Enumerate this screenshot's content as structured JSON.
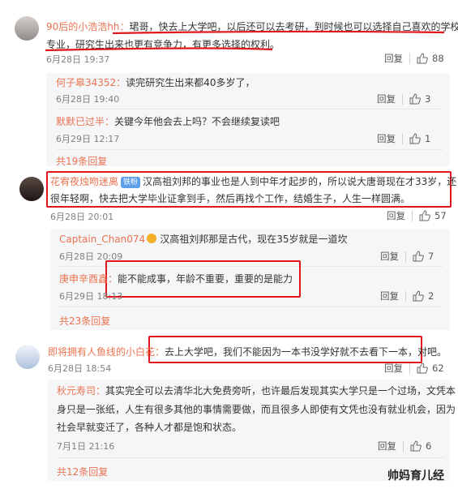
{
  "comments": [
    {
      "user": "90后的小浩浩hh：",
      "lines": [
        "珺哥，快去上大学吧，以后还可以去考研，到时候也可以选择自己喜欢的学校和",
        "专业，研究生出来也更有竞争力，有更多选择的权利。"
      ],
      "date": "6月28日 19:37",
      "reply": "回复",
      "likes": "88",
      "replies": [
        {
          "user": "何子皋34352：",
          "text": "读完研究生出来都40多岁了，",
          "date": "6月28日 19:40",
          "reply": "回复",
          "likes": "3"
        },
        {
          "user": "默默已过半：",
          "text": "关键今年他会去上吗？不会继续复读吧",
          "date": "6月29日 12:17",
          "reply": "回复",
          "likes": "1"
        }
      ],
      "more": "共19条回复"
    },
    {
      "user": "花宥夜烛吻迷离",
      "badge": "铁粉",
      "lines": [
        "汉高祖刘邦的事业也是人到中年才起步的，所以说大唐哥现在才33岁，还",
        "很年轻啊，快去把大学毕业证拿到手，然后再找个工作，结婚生子，人生一样圆满。"
      ],
      "date": "6月28日 20:01",
      "reply": "回复",
      "likes": "57",
      "replies": [
        {
          "user": "Captain_Chan074",
          "text": "汉高祖刘邦那是古代，现在35岁就是一道坎",
          "date": "6月28日 20:09",
          "reply": "回复",
          "likes": "7"
        },
        {
          "user": "庚申辛酉鑫：",
          "text": "能不能成事，年龄不重要，重要的是能力",
          "date": "6月29日 18:13",
          "reply": "回复",
          "likes": "2"
        }
      ],
      "more": "共23条回复"
    },
    {
      "user": "即将拥有人鱼线的小白花：",
      "lines": [
        "去上大学吧，我们不能因为一本书没学好就不去看下一本，对吧。"
      ],
      "date": "6月28日 18:54",
      "reply": "回复",
      "likes": "62",
      "replies": [
        {
          "user": "秋元寿司：",
          "lines": [
            "其实完全可以去清华北大免费旁听，也许最后发现其实大学只是一个过场，文凭本",
            "身只是一张纸，人生有很多其他的事情需要做，而且很多人即使有文凭也没有就业机会，因为",
            "社会早就变迁了，各种人才都是饱和状态。"
          ],
          "date": "7月1日 21:16",
          "reply": "回复",
          "likes": "6"
        }
      ],
      "more": "共12条回复"
    }
  ],
  "watermark": "帅妈育儿经",
  "colors": {
    "username": "#eb7350",
    "highlight": "#e0161c",
    "reply_bg": "#f5f6f8"
  }
}
